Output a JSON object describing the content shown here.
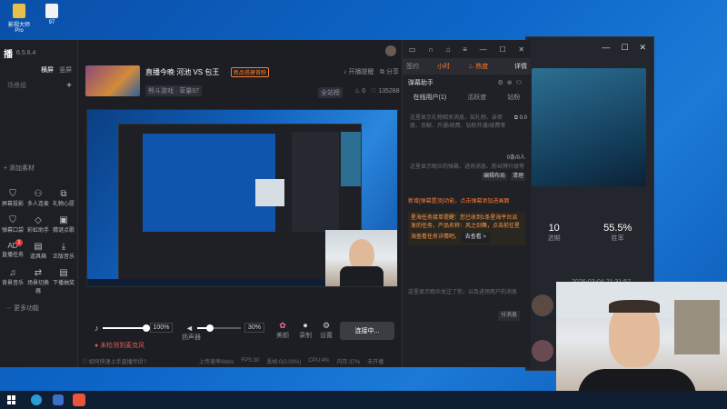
{
  "desktop": {
    "icons": [
      {
        "label": "影视大师Pro"
      },
      {
        "label": "97"
      }
    ]
  },
  "app": {
    "version": "6.5.6.4",
    "left": {
      "tabs": [
        "横屏",
        "竖屏"
      ],
      "scene_label": "场景组",
      "add_material": "添加素材",
      "tools": [
        {
          "label": "屏幕投影",
          "icon": "shield-icon"
        },
        {
          "label": "多人连麦",
          "icon": "people-icon"
        },
        {
          "label": "礼物心愿",
          "icon": "gift-icon"
        },
        {
          "label": "弹幕口袋",
          "icon": "shield-icon"
        },
        {
          "label": "彩虹助手",
          "icon": "diamond-icon"
        },
        {
          "label": "猜谜点歌",
          "icon": "calendar-icon"
        },
        {
          "label": "直播任务",
          "icon": "ad-icon",
          "badge": "1"
        },
        {
          "label": "道具箱",
          "icon": "box-icon"
        },
        {
          "label": "正版音乐",
          "icon": "download-icon"
        },
        {
          "label": "背景音乐",
          "icon": "music-icon"
        },
        {
          "label": "场景切换器",
          "icon": "switch-icon"
        },
        {
          "label": "下播抽奖",
          "icon": "box-icon"
        }
      ],
      "more_label": "更多功能"
    },
    "header": {
      "title": "直播今晚 河池 VS 包王",
      "badge": "新品搭建首映",
      "category": "熊斗游戏 · 草量97",
      "open_label": "开播提醒",
      "share_label": "分享",
      "rank": "全站榜",
      "likes": "0",
      "viewers": "135288"
    },
    "controls": {
      "mic_volume": "100%",
      "speaker_volume": "30%",
      "speaker_label": "扬声器",
      "mic_fill": 1.0,
      "speaker_fill": 0.3,
      "warning": "未检测到麦克风",
      "beauty": "美颜",
      "record": "录制",
      "settings": "设置",
      "start_button": "连接中..."
    },
    "status": {
      "help": "如何快速上手直播伴侣?",
      "bitrate": "上传速率0kb/s",
      "fps": "FPS:30",
      "dropped": "丢帧:0(0.00%)",
      "cpu": "CPU:4%",
      "memory": "内存:37%",
      "status": "未开播"
    }
  },
  "rightpanel": {
    "top_tabs": [
      "签约",
      "小时",
      "热度",
      "详情"
    ],
    "section_title": "弹幕助手",
    "subtabs": [
      "在线用户(1)",
      "活跃度",
      "钻粉"
    ],
    "gift_placeholder": "这里显示礼物相关消息，如礼物、亲密度、贡献、开通/续费、钻粉开通/续费等",
    "gift_amount": "0.0",
    "count": "0条/0人",
    "chat_placeholder": "这里显示观众的弹幕、进场消息、粉丝牌升级等",
    "edit_layout": "编辑布局",
    "clear": "清理",
    "notice": "新增[弹幕置顶]功能，点击弹幕添加进画面",
    "task": "星海任务接单提醒：您已收到1条星海平台派发的任务，产品名称：风之剑舞，点击前往星海查看任务详情吧。",
    "task_link": "去查看 >",
    "bottom_placeholder": "这里显示观众关注了你，以及进场用户的消息",
    "share_btn": "分消息"
  },
  "bgwindow": {
    "stat1_value": "10",
    "stat1_label": "选期",
    "stat2_value": "55.5%",
    "stat2_label": "胜率",
    "datetime": "2026-03-04 21:31:57"
  }
}
